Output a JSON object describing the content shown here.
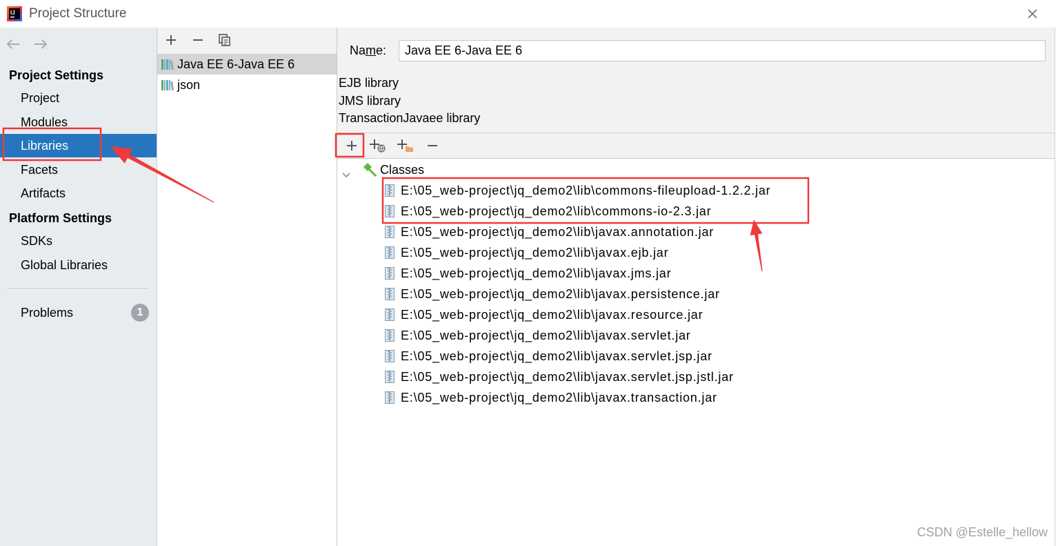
{
  "window": {
    "title": "Project Structure",
    "logo_text": "IJ",
    "icons": {
      "app": "intellij-logo-icon",
      "close": "close-icon"
    }
  },
  "navigation": {
    "icons": {
      "back": "arrow-left-icon",
      "forward": "arrow-right-icon"
    }
  },
  "sidebar": {
    "project_settings": {
      "header": "Project Settings",
      "items": [
        {
          "label": "Project",
          "selected": false
        },
        {
          "label": "Modules",
          "selected": false
        },
        {
          "label": "Libraries",
          "selected": true
        },
        {
          "label": "Facets",
          "selected": false
        },
        {
          "label": "Artifacts",
          "selected": false
        }
      ]
    },
    "platform_settings": {
      "header": "Platform Settings",
      "items": [
        {
          "label": "SDKs",
          "selected": false
        },
        {
          "label": "Global Libraries",
          "selected": false
        }
      ]
    },
    "problems": {
      "label": "Problems",
      "count": "1"
    }
  },
  "library_list": {
    "toolbar_icons": [
      "add-icon",
      "remove-icon",
      "copy-icon"
    ],
    "items": [
      {
        "name": "Java EE 6-Java EE 6",
        "selected": true,
        "icon": "library-icon"
      },
      {
        "name": "json",
        "selected": false,
        "icon": "library-icon"
      }
    ]
  },
  "library_detail": {
    "name_field": {
      "label_before": "Na",
      "label_mnemonic": "m",
      "label_after": "e:",
      "value": "Java EE 6-Java EE 6"
    },
    "library_kinds": [
      "EJB library",
      "JMS library",
      "TransactionJavaee library"
    ],
    "toolbar_icons": [
      "add-icon",
      "add-url-icon",
      "add-directory-icon",
      "remove-icon"
    ],
    "tree": {
      "root": {
        "label": "Classes",
        "expanded": true,
        "icon": "hammer-icon"
      },
      "entry_icon": "jar-icon",
      "entries": [
        "E:\\05_web-project\\jq_demo2\\lib\\commons-fileupload-1.2.2.jar",
        "E:\\05_web-project\\jq_demo2\\lib\\commons-io-2.3.jar",
        "E:\\05_web-project\\jq_demo2\\lib\\javax.annotation.jar",
        "E:\\05_web-project\\jq_demo2\\lib\\javax.ejb.jar",
        "E:\\05_web-project\\jq_demo2\\lib\\javax.jms.jar",
        "E:\\05_web-project\\jq_demo2\\lib\\javax.persistence.jar",
        "E:\\05_web-project\\jq_demo2\\lib\\javax.resource.jar",
        "E:\\05_web-project\\jq_demo2\\lib\\javax.servlet.jar",
        "E:\\05_web-project\\jq_demo2\\lib\\javax.servlet.jsp.jar",
        "E:\\05_web-project\\jq_demo2\\lib\\javax.servlet.jsp.jstl.jar",
        "E:\\05_web-project\\jq_demo2\\lib\\javax.transaction.jar"
      ]
    }
  },
  "watermark": "CSDN @Estelle_hellow",
  "colors": {
    "selection_blue": "#2675bf",
    "selection_gray": "#d5d5d5",
    "panel_gray": "#f2f2f2",
    "sidebar_bg": "#e9ecef",
    "badge_gray": "#9ea5ab",
    "annotation_red": "#ee3a3a"
  }
}
